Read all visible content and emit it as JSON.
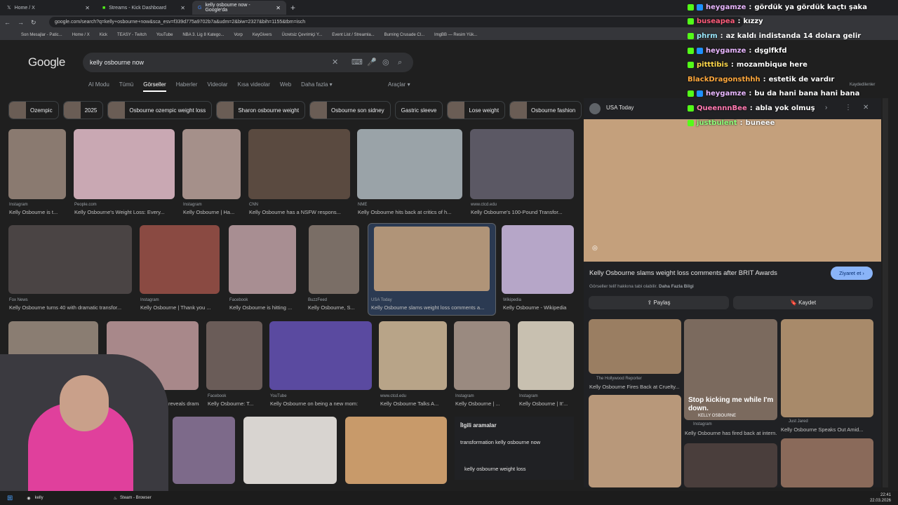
{
  "tabs": [
    {
      "label": "Home / X"
    },
    {
      "label": "Streams - Kick Dashboard"
    },
    {
      "label": "kelly osbourne now - Google'da"
    }
  ],
  "address": {
    "url": "google.com/search?q=kelly+osbourne+now&sca_esv=f339d775a9702b7a&udm=2&biw=2327&bih=1155&tbm=isch"
  },
  "bookmarks": [
    "Son Mesajlar - Patic...",
    "Home / X",
    "Kick",
    "TEASY - Twitch",
    "YouTube",
    "NBA 3. Lig 8 Katego...",
    "Vorp",
    "KeyGivers",
    "Ücretsiz Çevrimiçi Y...",
    "Event List / Streamla...",
    "Burning Crusade Cl...",
    "ImgBB — Resim Yük..."
  ],
  "google": {
    "logo": "Google",
    "query": "kelly osbourne now",
    "tabs": [
      "AI Modu",
      "Tümü",
      "Görseller",
      "Haberler",
      "Videolar",
      "Kısa videolar",
      "Web",
      "Daha fazla ▾"
    ],
    "tools": "Araçlar ▾",
    "chips": [
      "Ozempic",
      "2025",
      "Osbourne ozempic weight loss",
      "Sharon osbourne weight",
      "Osbourne son sidney",
      "Gastric sleeve",
      "Lose weight",
      "Osbourne fashion"
    ]
  },
  "results": [
    {
      "src": "Instagram",
      "cap": "Kelly Osbourne is t..."
    },
    {
      "src": "People.com",
      "cap": "Kelly Osbourne's Weight Loss: Every..."
    },
    {
      "src": "Instagram",
      "cap": "Kelly Osbourne | Ha..."
    },
    {
      "src": "CNN",
      "cap": "Kelly Osbourne has a NSFW respons..."
    },
    {
      "src": "NME",
      "cap": "Kelly Osbourne hits back at critics of h..."
    },
    {
      "src": "www.ctcd.edu",
      "cap": "Kelly Osbourne's 100-Pound Transfor..."
    },
    {
      "src": "Fox News",
      "cap": "Kelly Osbourne turns 40 with dramatic transfor..."
    },
    {
      "src": "Instagram",
      "cap": "Kelly Osbourne | Thank you ..."
    },
    {
      "src": "Facebook",
      "cap": "Kelly Osbourne is hitting ..."
    },
    {
      "src": "BuzzFeed",
      "cap": "Kelly Osbourne, S..."
    },
    {
      "src": "USA Today",
      "cap": "Kelly Osbourne slams weight loss comments a..."
    },
    {
      "src": "Wikipedia",
      "cap": "Kelly Osbourne - Wikipedia"
    },
    {
      "src": "",
      "cap": "reveals dramatic ..."
    },
    {
      "src": "Facebook",
      "cap": "Kelly Osbourne: T..."
    },
    {
      "src": "YouTube",
      "cap": "Kelly Osbourne on being a new mom:"
    },
    {
      "src": "www.ctcd.edu",
      "cap": "Kelly Osbourne Talks A..."
    },
    {
      "src": "Instagram",
      "cap": "Kelly Osbourne | ..."
    },
    {
      "src": "Instagram",
      "cap": "Kelly Osbourne | It'..."
    }
  ],
  "related": {
    "title": "İlgili aramalar",
    "items": [
      "transformation kelly osbourne now",
      "kelly osbourne weight loss"
    ]
  },
  "panel": {
    "source": "USA Today",
    "title": "Kelly Osbourne slams weight loss comments after BRIT Awards",
    "visit": "Ziyaret et ›",
    "notice": "Görseller telif hakkına tabi olabilir.",
    "more": "Daha Fazla Bilgi",
    "share": "Paylaş",
    "save": "Kaydet",
    "sub": [
      {
        "src": "The Hollywood Reporter",
        "cap": "Kelly Osbourne Fires Back at Cruelty..."
      },
      {
        "src": "Instagram",
        "cap": "Kelly Osbourne has fired back at intern..."
      },
      {
        "src": "Just Jared",
        "cap": "Kelly Osbourne Speaks Out Amid..."
      }
    ],
    "quote": "Stop kicking me while I'm down.",
    "quote_by": "KELLY OSBOURNE",
    "saved": "Kaydedilenler"
  },
  "chat": [
    {
      "user": "heygamze",
      "msg": "gördük ya gördük kaçtı şaka",
      "color": "#e9b7ff"
    },
    {
      "user": "buseapea",
      "msg": "kızzy",
      "color": "#ff5c7a"
    },
    {
      "user": "phrm",
      "msg": "az kaldı indistanda 14 dolara gelir",
      "color": "#9be9ff"
    },
    {
      "user": "heygamze",
      "msg": "dşglfkfd",
      "color": "#e9b7ff"
    },
    {
      "user": "pitttibis",
      "msg": "mozambique here",
      "color": "#ffd84a"
    },
    {
      "user": "BlackDragonsthhh",
      "msg": "estetik de vardır",
      "color": "#ffa83c"
    },
    {
      "user": "heygamze",
      "msg": "bu da hani bana hani bana",
      "color": "#e9b7ff"
    },
    {
      "user": "QueennnBee",
      "msg": "abla yok olmuş",
      "color": "#ff79b0"
    },
    {
      "user": "justbulent",
      "msg": "buneee",
      "color": "#8fff7a"
    }
  ],
  "taskbar": {
    "item1": "kelly",
    "item2": "Steam - Browser",
    "time": "22:41",
    "date": "22.03.2026"
  },
  "colors": {
    "accent": "#8ab4f8",
    "chip_border": "#3c4043"
  }
}
